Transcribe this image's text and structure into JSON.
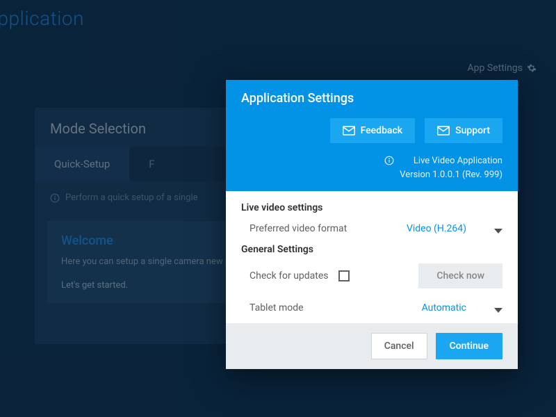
{
  "bg": {
    "appTitle": "eo Application",
    "appSettingsLink": "App Settings",
    "card": {
      "title": "Mode Selection",
      "tabs": [
        "Quick-Setup",
        "F"
      ],
      "infoText": "Perform a quick setup of a single",
      "welcome": {
        "title": "Welcome",
        "body": "Here you can setup a single camera\nnew project.",
        "cta": "Let's get started."
      }
    }
  },
  "modal": {
    "title": "Application Settings",
    "feedback": "Feedback",
    "support": "Support",
    "appName": "Live Video Application",
    "version": "Version 1.0.0.1 (Rev. 999)",
    "sections": {
      "liveVideo": {
        "title": "Live video settings",
        "formatLabel": "Preferred video format",
        "formatValue": "Video (H.264)"
      },
      "general": {
        "title": "General Settings",
        "updatesLabel": "Check for updates",
        "checkNow": "Check now",
        "tabletLabel": "Tablet mode",
        "tabletValue": "Automatic"
      }
    },
    "footer": {
      "cancel": "Cancel",
      "continue": "Continue"
    }
  }
}
